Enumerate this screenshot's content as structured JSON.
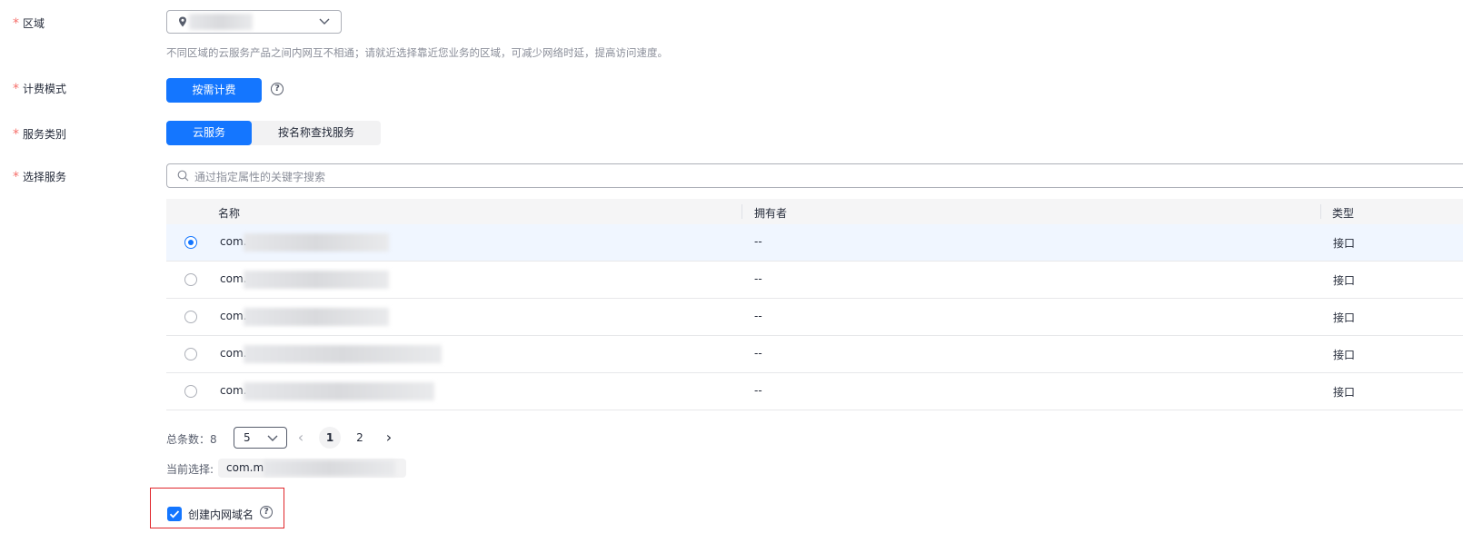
{
  "form": {
    "region": {
      "label": "区域",
      "required_mark": "*",
      "hint": "不同区域的云服务产品之间内网互不相通；请就近选择靠近您业务的区域，可减少网络时延，提高访问速度。"
    },
    "billing": {
      "label": "计费模式",
      "required_mark": "*",
      "option_label": "按需计费",
      "help_glyph": "?"
    },
    "service_type": {
      "label": "服务类别",
      "required_mark": "*",
      "tabs": [
        "云服务",
        "按名称查找服务"
      ]
    },
    "select_service": {
      "label": "选择服务",
      "required_mark": "*",
      "search_placeholder": "通过指定属性的关键字搜索"
    }
  },
  "table": {
    "columns": [
      "名称",
      "拥有者",
      "类型"
    ],
    "rows": [
      {
        "name": "com.",
        "owner": "--",
        "type": "接口",
        "selected": true
      },
      {
        "name": "com.",
        "owner": "--",
        "type": "接口",
        "selected": false
      },
      {
        "name": "com.",
        "owner": "--",
        "type": "接口",
        "selected": false
      },
      {
        "name": "com.",
        "owner": "--",
        "type": "接口",
        "selected": false
      },
      {
        "name": "com.",
        "owner": "--",
        "type": "接口",
        "selected": false
      }
    ]
  },
  "pagination": {
    "total_label": "总条数：8",
    "page_size": "5",
    "prev_glyph": "‹",
    "next_glyph": "›",
    "pages": [
      "1",
      "2"
    ],
    "current_page": "1"
  },
  "selection": {
    "label": "当前选择:",
    "value": "com.m"
  },
  "private_dns": {
    "label": "创建内网域名",
    "checked": true,
    "help_glyph": "?"
  },
  "colors": {
    "primary": "#1476ff",
    "required": "#f66f6a",
    "highlight_border": "#e0262b"
  }
}
